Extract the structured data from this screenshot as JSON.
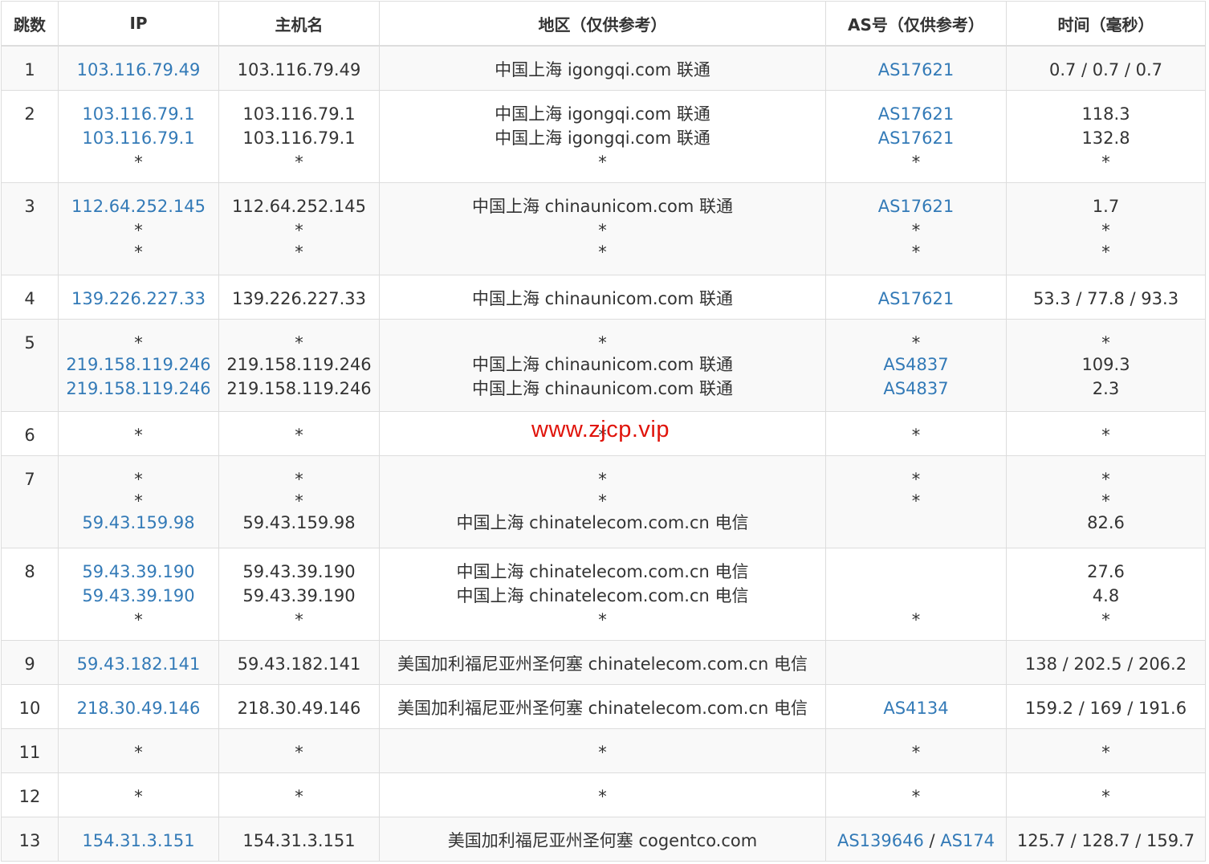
{
  "headers": [
    "跳数",
    "IP",
    "主机名",
    "地区（仅供参考）",
    "AS号（仅供参考）",
    "时间（毫秒）"
  ],
  "watermark": "www.zjcp.vip",
  "rows": [
    {
      "hop": "1",
      "ip": [
        "103.116.79.49"
      ],
      "host": [
        "103.116.79.49"
      ],
      "region": [
        "中国上海 igongqi.com 联通"
      ],
      "as": [
        [
          "AS17621"
        ]
      ],
      "time": [
        "0.7 / 0.7 / 0.7"
      ]
    },
    {
      "hop": "2",
      "ip": [
        "103.116.79.1",
        "103.116.79.1",
        "*"
      ],
      "host": [
        "103.116.79.1",
        "103.116.79.1",
        "*"
      ],
      "region": [
        "中国上海 igongqi.com 联通",
        "中国上海 igongqi.com 联通",
        "*"
      ],
      "as": [
        [
          "AS17621"
        ],
        [
          "AS17621"
        ],
        [
          "*"
        ]
      ],
      "time": [
        "118.3",
        "132.8",
        "*"
      ]
    },
    {
      "hop": "3",
      "ip": [
        "112.64.252.145",
        "*",
        "*"
      ],
      "host": [
        "112.64.252.145",
        "*",
        "*"
      ],
      "region": [
        "中国上海 chinaunicom.com 联通",
        "*",
        "*"
      ],
      "as": [
        [
          "AS17621"
        ],
        [
          "*"
        ],
        [
          "*"
        ]
      ],
      "time": [
        "1.7",
        "*",
        "*"
      ]
    },
    {
      "hop": "4",
      "ip": [
        "139.226.227.33"
      ],
      "host": [
        "139.226.227.33"
      ],
      "region": [
        "中国上海 chinaunicom.com 联通"
      ],
      "as": [
        [
          "AS17621"
        ]
      ],
      "time": [
        "53.3 / 77.8 / 93.3"
      ]
    },
    {
      "hop": "5",
      "ip": [
        "*",
        "219.158.119.246",
        "219.158.119.246"
      ],
      "host": [
        "*",
        "219.158.119.246",
        "219.158.119.246"
      ],
      "region": [
        "*",
        "中国上海 chinaunicom.com 联通",
        "中国上海 chinaunicom.com 联通"
      ],
      "as": [
        [
          "*"
        ],
        [
          "AS4837"
        ],
        [
          "AS4837"
        ]
      ],
      "time": [
        "*",
        "109.3",
        "2.3"
      ]
    },
    {
      "hop": "6",
      "ip": [
        "*"
      ],
      "host": [
        "*"
      ],
      "region": [
        "*"
      ],
      "as": [
        [
          "*"
        ]
      ],
      "time": [
        "*"
      ]
    },
    {
      "hop": "7",
      "ip": [
        "*",
        "*",
        "59.43.159.98"
      ],
      "host": [
        "*",
        "*",
        "59.43.159.98"
      ],
      "region": [
        "*",
        "*",
        "中国上海 chinatelecom.com.cn 电信"
      ],
      "as": [
        [
          "*"
        ],
        [
          "*"
        ],
        [
          ""
        ]
      ],
      "time": [
        "*",
        "*",
        "82.6"
      ]
    },
    {
      "hop": "8",
      "ip": [
        "59.43.39.190",
        "59.43.39.190",
        "*"
      ],
      "host": [
        "59.43.39.190",
        "59.43.39.190",
        "*"
      ],
      "region": [
        "中国上海 chinatelecom.com.cn 电信",
        "中国上海 chinatelecom.com.cn 电信",
        "*"
      ],
      "as": [
        [
          ""
        ],
        [
          ""
        ],
        [
          "*"
        ]
      ],
      "time": [
        "27.6",
        "4.8",
        "*"
      ]
    },
    {
      "hop": "9",
      "ip": [
        "59.43.182.141"
      ],
      "host": [
        "59.43.182.141"
      ],
      "region": [
        "美国加利福尼亚州圣何塞 chinatelecom.com.cn 电信"
      ],
      "as": [
        [
          ""
        ]
      ],
      "time": [
        "138 / 202.5 / 206.2"
      ]
    },
    {
      "hop": "10",
      "ip": [
        "218.30.49.146"
      ],
      "host": [
        "218.30.49.146"
      ],
      "region": [
        "美国加利福尼亚州圣何塞 chinatelecom.com.cn 电信"
      ],
      "as": [
        [
          "AS4134"
        ]
      ],
      "time": [
        "159.2 / 169 / 191.6"
      ]
    },
    {
      "hop": "11",
      "ip": [
        "*"
      ],
      "host": [
        "*"
      ],
      "region": [
        "*"
      ],
      "as": [
        [
          "*"
        ]
      ],
      "time": [
        "*"
      ]
    },
    {
      "hop": "12",
      "ip": [
        "*"
      ],
      "host": [
        "*"
      ],
      "region": [
        "*"
      ],
      "as": [
        [
          "*"
        ]
      ],
      "time": [
        "*"
      ]
    },
    {
      "hop": "13",
      "ip": [
        "154.31.3.151"
      ],
      "host": [
        "154.31.3.151"
      ],
      "region": [
        "美国加利福尼亚州圣何塞 cogentco.com"
      ],
      "as": [
        [
          "AS139646",
          "AS174"
        ]
      ],
      "time": [
        "125.7 / 128.7 / 159.7"
      ]
    }
  ]
}
